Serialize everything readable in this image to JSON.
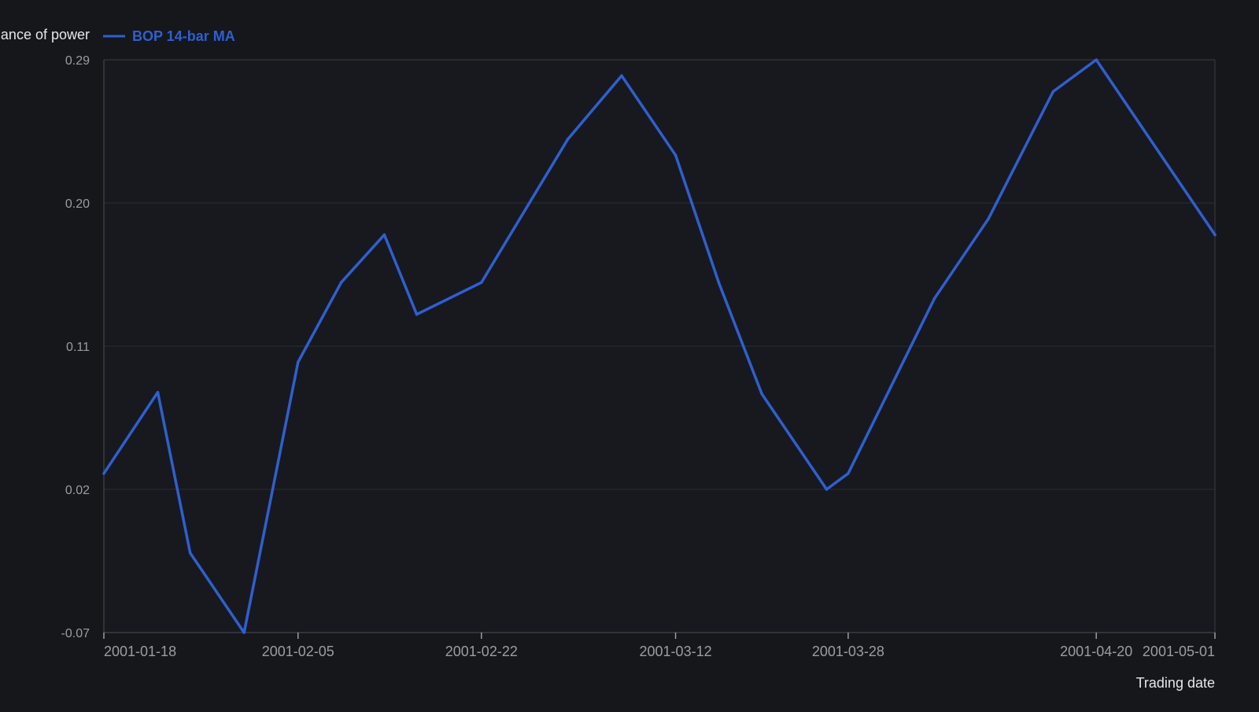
{
  "colors": {
    "background": "#15171b",
    "plot_background": "#17191e",
    "grid": "#2a2d33",
    "axis": "#3a3d44",
    "tick_text": "#9a9da3",
    "label_text": "#e6e7e9",
    "series": "#2f5fd0"
  },
  "chart_data": {
    "type": "line",
    "ylabel": "Balance of power",
    "xlabel": "Trading date",
    "legend": {
      "placement": "top-left",
      "entries": [
        "BOP 14-bar MA"
      ]
    },
    "grid": true,
    "ylim": [
      -0.07,
      0.29
    ],
    "yticks": [
      -0.07,
      0.02,
      0.11,
      0.2,
      0.29
    ],
    "ytick_labels": [
      "-0.07",
      "0.02",
      "0.11",
      "0.20",
      "0.29"
    ],
    "xlim": [
      "2001-01-18",
      "2001-05-01"
    ],
    "xticks": [
      "2001-01-18",
      "2001-02-05",
      "2001-02-22",
      "2001-03-12",
      "2001-03-28",
      "2001-04-20",
      "2001-05-01"
    ],
    "series": [
      {
        "name": "BOP 14-bar MA",
        "color": "#2f5fd0",
        "x": [
          "2001-01-18",
          "2001-01-23",
          "2001-01-26",
          "2001-01-31",
          "2001-02-05",
          "2001-02-09",
          "2001-02-13",
          "2001-02-16",
          "2001-02-22",
          "2001-03-02",
          "2001-03-07",
          "2001-03-12",
          "2001-03-16",
          "2001-03-20",
          "2001-03-26",
          "2001-03-28",
          "2001-04-05",
          "2001-04-10",
          "2001-04-16",
          "2001-04-20",
          "2001-04-24",
          "2001-05-01"
        ],
        "y": [
          0.03,
          0.081,
          -0.02,
          -0.07,
          0.1,
          0.15,
          0.18,
          0.13,
          0.15,
          0.24,
          0.28,
          0.23,
          0.15,
          0.08,
          0.02,
          0.03,
          0.14,
          0.19,
          0.27,
          0.29,
          0.25,
          0.18
        ]
      }
    ]
  }
}
